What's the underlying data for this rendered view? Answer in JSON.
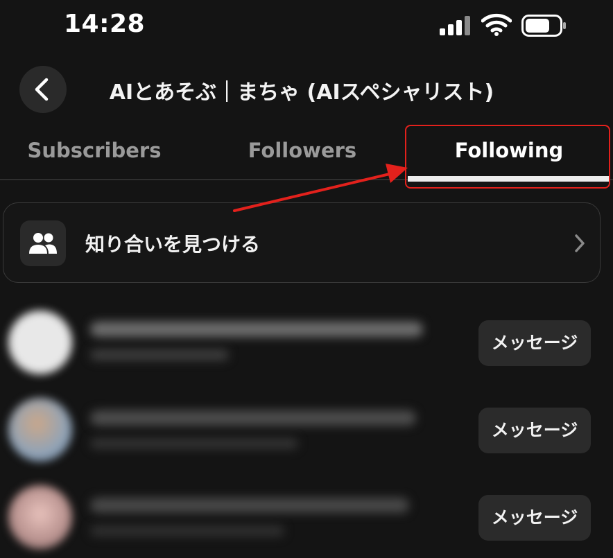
{
  "status_bar": {
    "time": "14:28",
    "icons": [
      "cellular-signal-icon",
      "wifi-icon",
      "battery-icon"
    ]
  },
  "header": {
    "back_icon": "chevron-left-icon",
    "title": "AIとあそぶ｜まちゃ (AIスペシャリスト)"
  },
  "tabs": [
    {
      "label": "Subscribers",
      "active": false
    },
    {
      "label": "Followers",
      "active": false
    },
    {
      "label": "Following",
      "active": true
    }
  ],
  "find_friends": {
    "icon": "people-icon",
    "label": "知り合いを見つける",
    "chevron": "chevron-right-icon"
  },
  "following_list": [
    {
      "button_label": "メッセージ",
      "content_blurred": true
    },
    {
      "button_label": "メッセージ",
      "content_blurred": true
    },
    {
      "button_label": "メッセージ",
      "content_blurred": true
    }
  ],
  "annotation": {
    "highlight_color": "#e3211c",
    "arrow_color": "#e3211c"
  },
  "colors": {
    "background": "#141414",
    "text": "#f2f2f2",
    "inactive_tab": "#9a9a9a",
    "button_bg": "#2b2b2b"
  }
}
